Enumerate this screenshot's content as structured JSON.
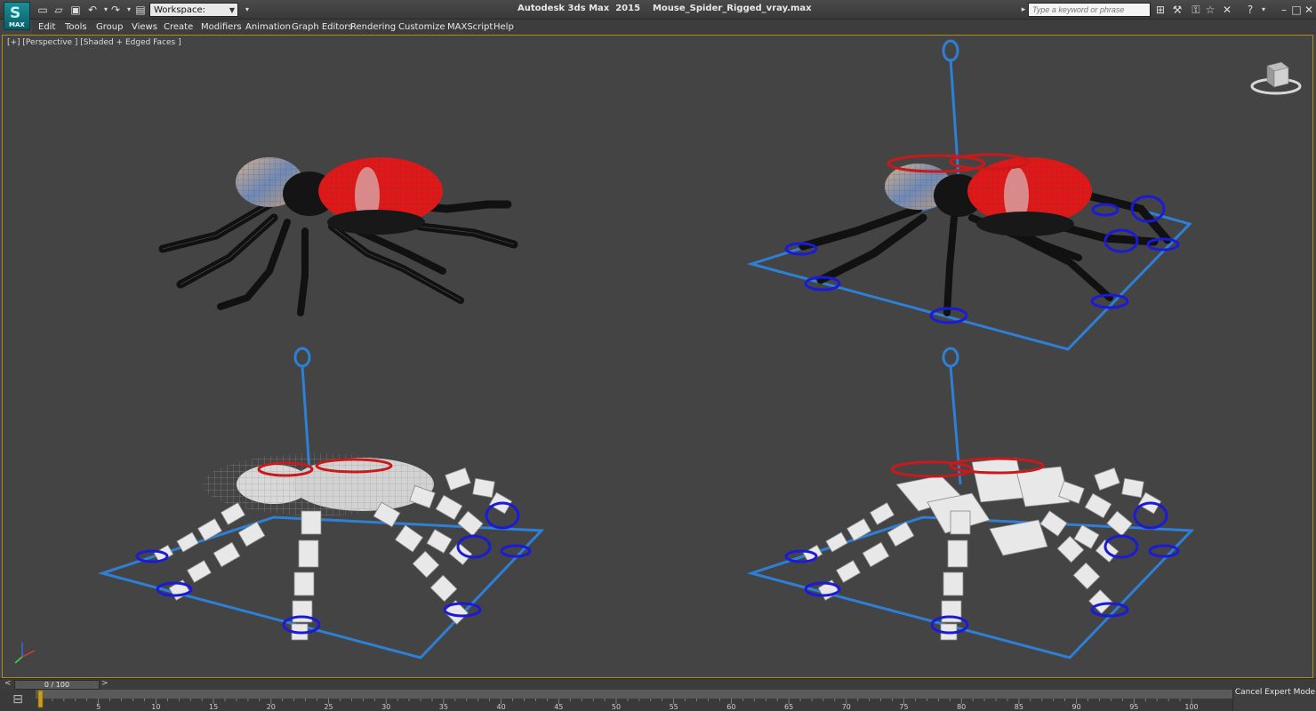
{
  "app": {
    "title": "Autodesk 3ds Max  2015    Mouse_Spider_Rigged_vray.max",
    "logo_label": "MAX"
  },
  "quick_access": {
    "workspace_label": "Workspace: Default",
    "icons": [
      "new-file-icon",
      "open-file-icon",
      "save-icon",
      "undo-icon",
      "redo-icon",
      "project-folder-icon"
    ]
  },
  "search": {
    "placeholder": "Type a keyword or phrase"
  },
  "menu": {
    "items": [
      "Edit",
      "Tools",
      "Group",
      "Views",
      "Create",
      "Modifiers",
      "Animation",
      "Graph Editors",
      "Rendering",
      "Customize",
      "MAXScript",
      "Help"
    ]
  },
  "viewport": {
    "label": "[+] [Perspective ] [Shaded + Edged Faces ]",
    "border_color": "#b08a1a"
  },
  "timeline": {
    "frame_display": "0 / 100",
    "prev": "<",
    "next": ">",
    "ticks": [
      "5",
      "10",
      "15",
      "20",
      "25",
      "30",
      "35",
      "40",
      "45",
      "50",
      "55",
      "60",
      "65",
      "70",
      "75",
      "80",
      "85",
      "90",
      "95",
      "100"
    ]
  },
  "status": {
    "cancel_expert_mode": "Cancel Expert Mode"
  },
  "colors": {
    "rig_blue": "#2e7fd6",
    "control_red": "#d01a1a",
    "ring_blue": "#1a1ad8"
  }
}
